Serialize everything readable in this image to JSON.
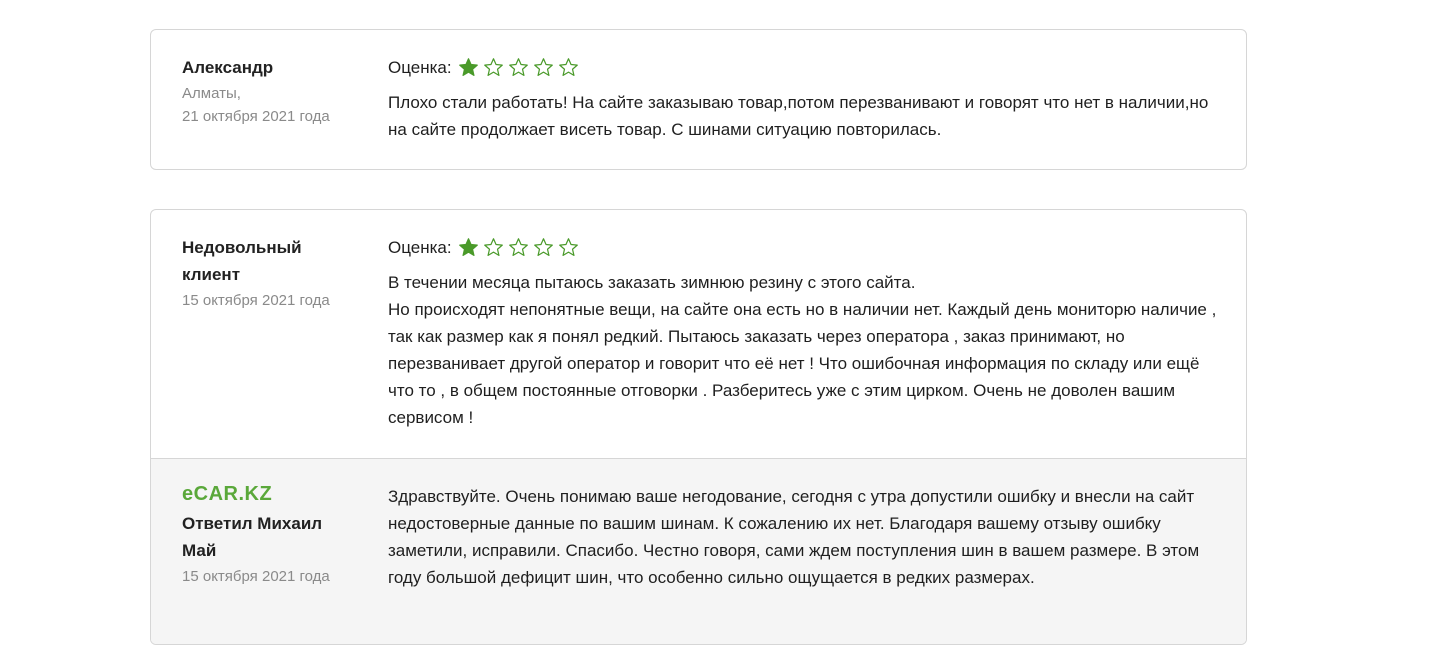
{
  "reviews": [
    {
      "author": "Александр",
      "city": "Алматы,",
      "date": "21 октября 2021 года",
      "rating_label": "Оценка:",
      "rating": 1,
      "max_rating": 5,
      "text": "Плохо стали работать! На сайте заказываю товар,потом перезванивают и говорят что нет в наличии,но на сайте продолжает висеть товар. С шинами ситуацию повторилась."
    },
    {
      "author": "Недовольный клиент",
      "date": "15 октября 2021 года",
      "rating_label": "Оценка:",
      "rating": 1,
      "max_rating": 5,
      "text": "В течении месяца пытаюсь заказать зимнюю резину с этого сайта.\nНо происходят непонятные вещи, на сайте она есть но в наличии нет. Каждый день мониторю наличие , так как размер как я понял редкий. Пытаюсь заказать через оператора , заказ принимают, но перезванивает другой оператор и говорит что её нет ! Что ошибочная информация по складу или ещё что то , в общем постоянные отговорки . Разберитесь уже с этим цирком. Очень не доволен вашим сервисом !",
      "reply": {
        "logo": "eCAR.KZ",
        "author": "Ответил Михаил Май",
        "date": "15 октября 2021 года",
        "text": "Здравствуйте. Очень понимаю ваше негодование, сегодня с утра допустили ошибку и внесли на сайт недостоверные данные по вашим шинам. К сожалению их нет. Благодаря вашему отзыву ошибку заметили, исправили. Спасибо. Честно говоря, сами ждем поступления шин в вашем размере. В этом году большой дефицит шин, что особенно сильно ощущается в редких размерах."
      }
    }
  ],
  "colors": {
    "star": "#4a9a2a",
    "logo": "#5aa83a",
    "border": "#d6d6d6",
    "reply_bg": "#f5f5f5",
    "muted": "#8a8a8a"
  },
  "icons": {
    "star_filled": "star-filled-icon",
    "star_empty": "star-outline-icon"
  }
}
